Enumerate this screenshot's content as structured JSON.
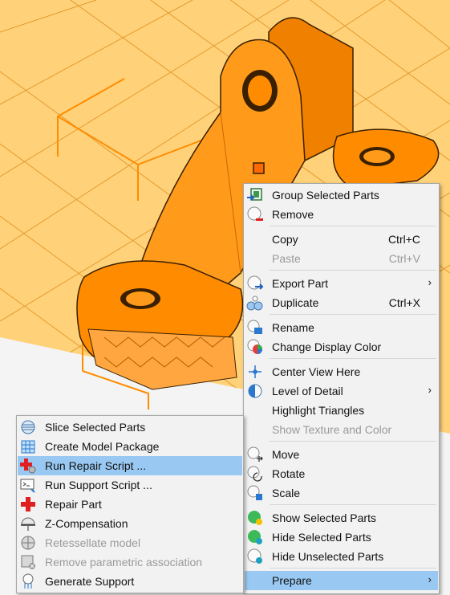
{
  "colors": {
    "part_fill": "#ff8c00",
    "plate_bg": "#ffd27a",
    "grid_line": "#e49a2e",
    "menu_bg": "#f2f2f2",
    "highlight": "#99c9f2",
    "disabled_text": "#9a9a9a"
  },
  "context_menu": {
    "items": [
      {
        "label": "Group Selected Parts",
        "icon": "group-parts-icon"
      },
      {
        "label": "Remove",
        "icon": "remove-icon"
      },
      {
        "label": "Copy",
        "shortcut": "Ctrl+C"
      },
      {
        "label": "Paste",
        "shortcut": "Ctrl+V",
        "disabled": true
      },
      {
        "label": "Export Part",
        "icon": "export-part-icon",
        "submenu": true
      },
      {
        "label": "Duplicate",
        "icon": "duplicate-icon",
        "shortcut": "Ctrl+X"
      },
      {
        "label": "Rename",
        "icon": "rename-icon"
      },
      {
        "label": "Change Display Color",
        "icon": "color-wheel-icon"
      },
      {
        "label": "Center View Here",
        "icon": "center-view-icon"
      },
      {
        "label": "Level of Detail",
        "icon": "level-of-detail-icon",
        "submenu": true
      },
      {
        "label": "Highlight Triangles"
      },
      {
        "label": "Show Texture and Color",
        "disabled": true
      },
      {
        "label": "Move",
        "icon": "move-icon"
      },
      {
        "label": "Rotate",
        "icon": "rotate-icon"
      },
      {
        "label": "Scale",
        "icon": "scale-icon"
      },
      {
        "label": "Show Selected Parts",
        "icon": "show-parts-icon"
      },
      {
        "label": "Hide Selected Parts",
        "icon": "hide-parts-icon"
      },
      {
        "label": "Hide Unselected Parts",
        "icon": "hide-unselected-icon"
      },
      {
        "label": "Prepare",
        "submenu": true,
        "highlighted": true
      }
    ]
  },
  "prepare_submenu": {
    "items": [
      {
        "label": "Slice Selected Parts",
        "icon": "slice-icon"
      },
      {
        "label": "Create Model Package",
        "icon": "model-package-icon"
      },
      {
        "label": "Run Repair Script ...",
        "icon": "repair-script-icon",
        "highlighted": true
      },
      {
        "label": "Run Support Script ...",
        "icon": "support-script-icon"
      },
      {
        "label": "Repair Part",
        "icon": "repair-cross-icon"
      },
      {
        "label": "Z-Compensation",
        "icon": "z-compensation-icon"
      },
      {
        "label": "Retessellate model",
        "icon": "retessellate-icon",
        "disabled": true
      },
      {
        "label": "Remove parametric association",
        "icon": "remove-parametric-icon",
        "disabled": true
      },
      {
        "label": "Generate Support",
        "icon": "generate-support-icon"
      }
    ]
  }
}
